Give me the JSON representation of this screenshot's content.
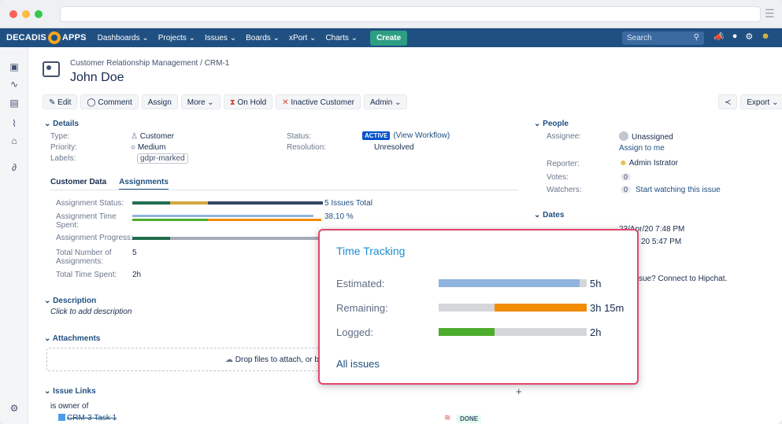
{
  "nav": {
    "brand_left": "DECADIS",
    "brand_right": "APPS",
    "items": [
      "Dashboards ⌄",
      "Projects ⌄",
      "Issues ⌄",
      "Boards ⌄",
      "xPort ⌄",
      "Charts ⌄"
    ],
    "create": "Create",
    "search_placeholder": "Search"
  },
  "issue": {
    "breadcrumb": "Customer Relationship Management / CRM-1",
    "title": "John Doe"
  },
  "toolbar": {
    "edit": "✎ Edit",
    "comment": "Comment",
    "assign": "Assign",
    "more": "More ⌄",
    "on_hold": "On Hold",
    "inactive": "Inactive Customer",
    "admin": "Admin ⌄",
    "export": "Export ⌄"
  },
  "details": {
    "heading": "Details",
    "type_label": "Type:",
    "type_value": "Customer",
    "priority_label": "Priority:",
    "priority_value": "Medium",
    "labels_label": "Labels:",
    "labels_value": "gdpr-marked",
    "status_label": "Status:",
    "status_badge": "ACTIVE",
    "status_link": "(View Workflow)",
    "resolution_label": "Resolution:",
    "resolution_value": "Unresolved"
  },
  "tabs": [
    "Customer Data",
    "Assignments"
  ],
  "assignments": {
    "status_label": "Assignment Status:",
    "status_value": "5 Issues Total",
    "time_label_1": "Assignment Time",
    "time_label_2": "Spent:",
    "time_value": "38.10 %",
    "progress_label": "Assignment Progress:",
    "total_label_1": "Total Number of",
    "total_label_2": "Assignments:",
    "total_value": "5",
    "time_spent_label": "Total Time Spent:",
    "time_spent_value": "2h"
  },
  "description": {
    "heading": "Description",
    "placeholder": "Click to add description"
  },
  "attachments": {
    "heading": "Attachments",
    "drop_text": "Drop files to attach, or br"
  },
  "issue_links": {
    "heading": "Issue Links",
    "relation": "is owner of",
    "item": "CRM-3 Task 1",
    "status": "DONE"
  },
  "people": {
    "heading": "People",
    "assignee_label": "Assignee:",
    "assignee_value": "Unassigned",
    "assign_me": "Assign to me",
    "reporter_label": "Reporter:",
    "reporter_value": "Admin Istrator",
    "votes_label": "Votes:",
    "votes_value": "0",
    "watchers_label": "Watchers:",
    "watchers_value": "0",
    "watch_link": "Start watching this issue"
  },
  "dates": {
    "heading": "Dates",
    "created_partial": "23/Apr/20 7:48 PM",
    "updated_partial": "20 5:47 PM",
    "hipchat_partial": "sue? Connect to Hipchat."
  },
  "time_tracking": {
    "title": "Time Tracking",
    "estimated_label": "Estimated:",
    "estimated_value": "5h",
    "estimated_fraction": 0.95,
    "remaining_label": "Remaining:",
    "remaining_value": "3h 15m",
    "remaining_fraction": 0.62,
    "logged_label": "Logged:",
    "logged_value": "2h",
    "logged_fraction": 0.38,
    "all_issues": "All issues"
  },
  "colors": {
    "nav": "#205081",
    "accent_green": "#4cac2b",
    "accent_orange": "#f28c00",
    "accent_blue": "#8fb4dd",
    "popup_border": "#e2466c"
  }
}
